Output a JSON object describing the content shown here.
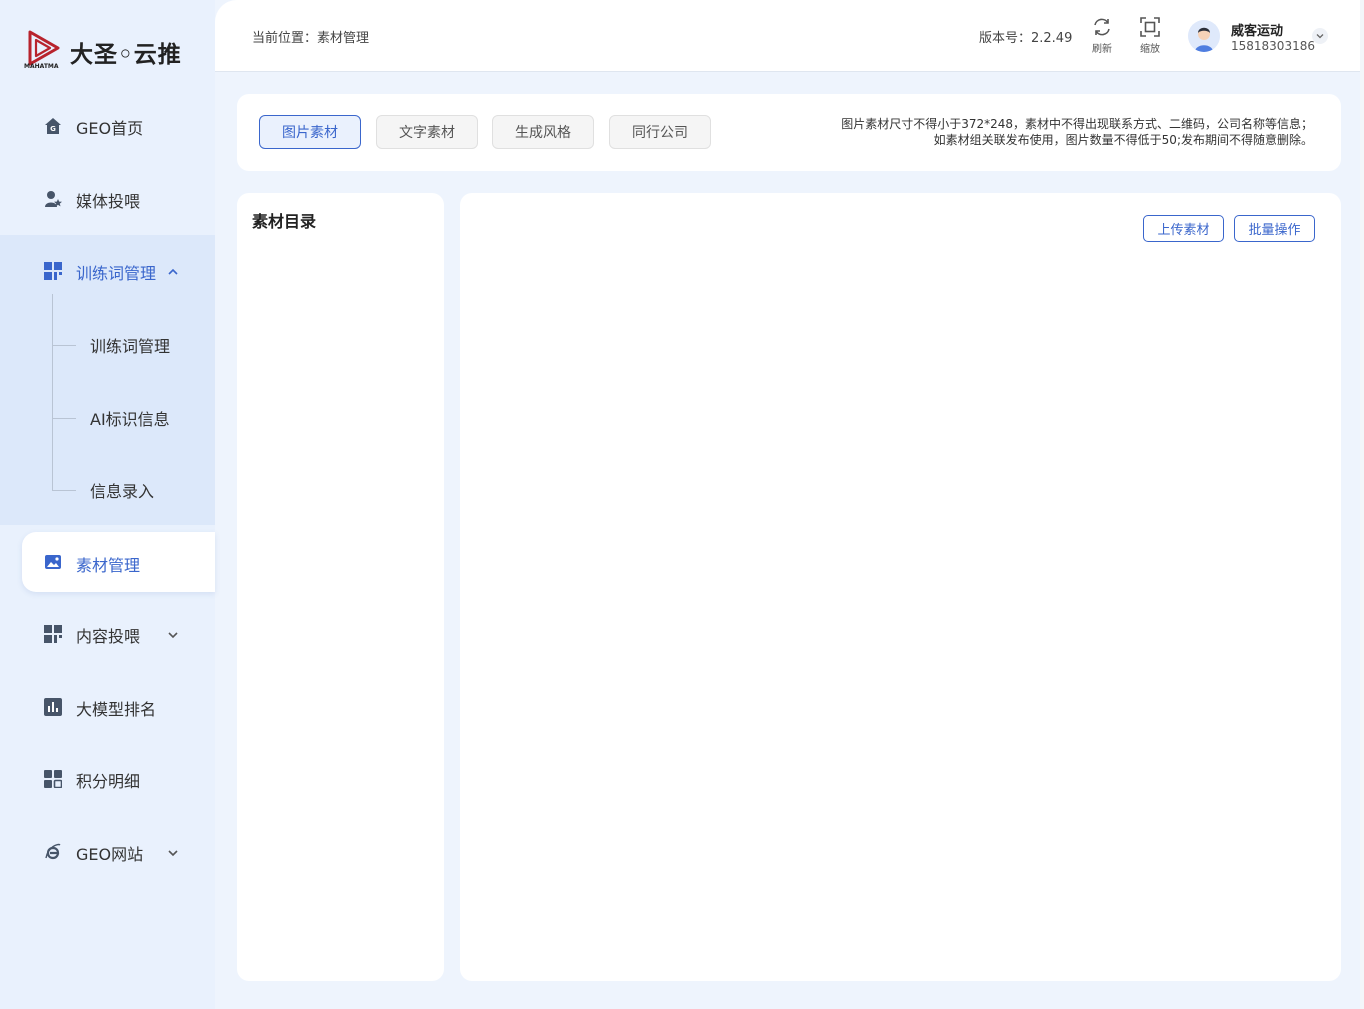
{
  "brand": {
    "name": "大圣◦云推",
    "sub": "MAHATMA",
    "accent": "#3a66cc"
  },
  "sidebar": {
    "items": [
      {
        "label": "GEO首页",
        "icon": "home-icon"
      },
      {
        "label": "媒体投喂",
        "icon": "user-star-icon"
      },
      {
        "label": "训练词管理",
        "icon": "grid-icon",
        "expanded": true,
        "children": [
          {
            "label": "训练词管理"
          },
          {
            "label": "AI标识信息"
          },
          {
            "label": "信息录入"
          }
        ]
      },
      {
        "label": "素材管理",
        "icon": "image-icon",
        "active": true
      },
      {
        "label": "内容投喂",
        "icon": "grid-icon"
      },
      {
        "label": "大模型排名",
        "icon": "bar-chart-icon"
      },
      {
        "label": "积分明细",
        "icon": "grid-icon"
      },
      {
        "label": "GEO网站",
        "icon": "ie-browser-icon"
      }
    ]
  },
  "header": {
    "breadcrumb": "当前位置：素材管理",
    "version": "版本号：2.2.49",
    "refresh_label": "刷新",
    "zoom_label": "缩放",
    "user_name": "威客运动",
    "user_phone": "15818303186"
  },
  "tabs": [
    {
      "label": "图片素材",
      "active": true
    },
    {
      "label": "文字素材"
    },
    {
      "label": "生成风格"
    },
    {
      "label": "同行公司"
    }
  ],
  "notice": {
    "line1": "图片素材尺寸不得小于372*248，素材中不得出现联系方式、二维码，公司名称等信息；",
    "line2": "如素材组关联发布使用，图片数量不得低于50;发布期间不得随意删除。"
  },
  "directory": {
    "title": "素材目录"
  },
  "content": {
    "upload_label": "上传素材",
    "batch_label": "批量操作"
  }
}
